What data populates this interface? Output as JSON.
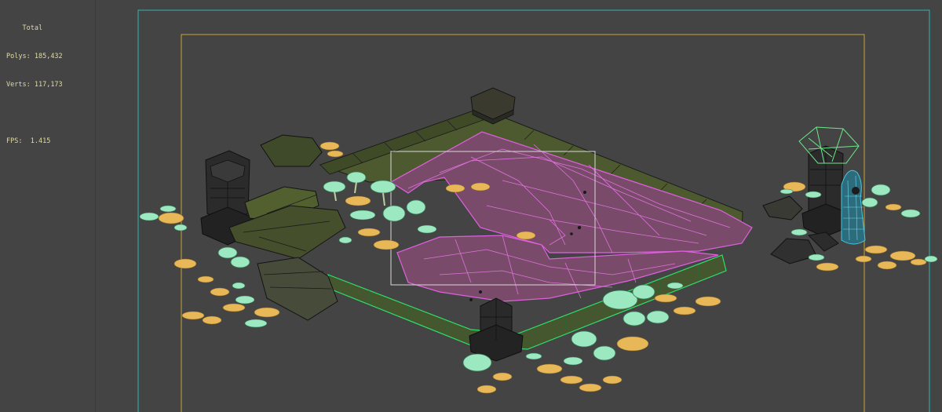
{
  "viewport": {
    "stats": {
      "total_label": "Total",
      "polys_label": "Polys:",
      "polys_value": "185,432",
      "verts_label": "Verts:",
      "verts_value": "117,173",
      "fps_label": "FPS:",
      "fps_value": "1.415"
    },
    "colors": {
      "background": "#444444",
      "safe_frame_outer": "#2fb5b5",
      "safe_frame_inner": "#c9a53a",
      "wire_selected": "#e060e0",
      "wire_green": "#2ee06a",
      "wire_cyan": "#48c8e0",
      "stone": "#4a5a30",
      "dark_stone": "#2b2b2b",
      "leaf_yellow": "#e8b858",
      "leaf_mint": "#9ce8c0",
      "selection_box": "#d8d8d8"
    },
    "scene_objects": [
      "floor-tiles",
      "selected-floor-mesh",
      "stone-pillar",
      "stone-lantern",
      "mushroom-plant",
      "lily-pad-leaves",
      "rock-slabs",
      "selection-rectangle"
    ]
  }
}
